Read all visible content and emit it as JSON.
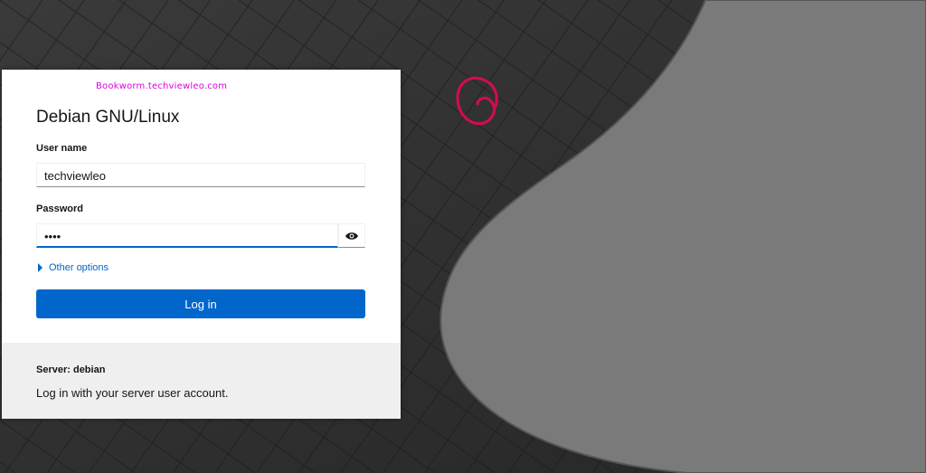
{
  "background": {
    "base_color": "#2e2e2e",
    "curve_color": "#7c7c7c",
    "logo_color": "#d70a53"
  },
  "login": {
    "watermark": "Bookworm.techviewleo.com",
    "title": "Debian GNU/Linux",
    "username_label": "User name",
    "username_value": "techviewleo",
    "password_label": "Password",
    "password_value": "••••",
    "other_options": "Other options",
    "login_button": "Log in",
    "server_text": "Server: debian",
    "hint_text": "Log in with your server user account."
  },
  "colors": {
    "accent": "#0066cc",
    "footer": "#efefef"
  }
}
